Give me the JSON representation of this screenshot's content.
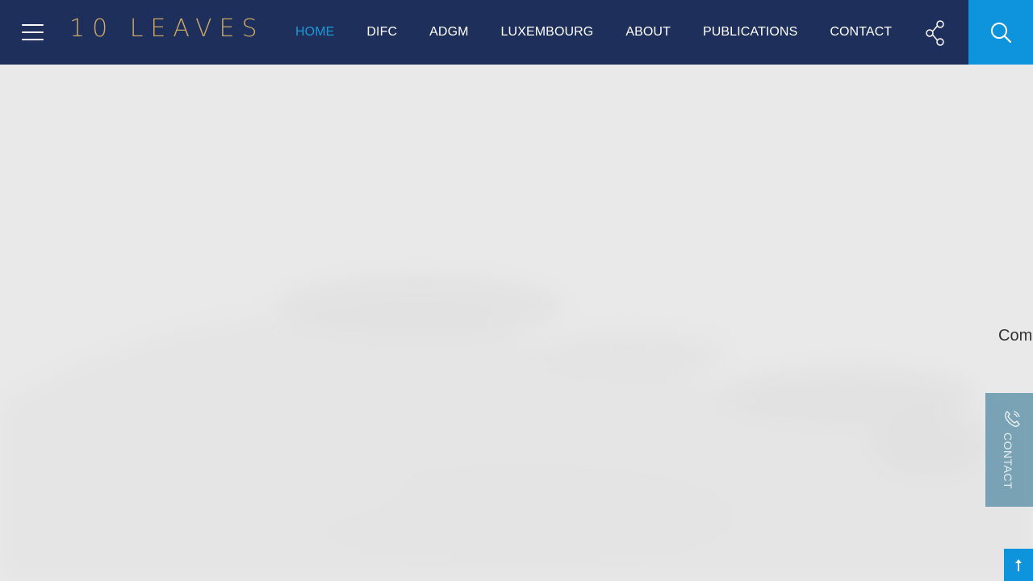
{
  "header": {
    "logo_text": "10 LEAVES",
    "nav": [
      {
        "label": "HOME",
        "active": true
      },
      {
        "label": "DIFC"
      },
      {
        "label": "ADGM"
      },
      {
        "label": "LUXEMBOURG"
      },
      {
        "label": "ABOUT"
      },
      {
        "label": "PUBLICATIONS"
      },
      {
        "label": "CONTACT"
      }
    ],
    "icons": {
      "menu": "hamburger-menu-icon",
      "share": "share-icon",
      "search": "search-icon"
    }
  },
  "hero": {
    "partial_text": "Com"
  },
  "contact_tab": {
    "label": "CONTACT",
    "icon": "phone-icon"
  },
  "back_to_top": {
    "icon": "arrow-up-icon"
  },
  "colors": {
    "header_bg": "#1f2f5b",
    "accent_blue": "#0e94dc",
    "active_nav": "#1b9ad8",
    "logo_gold": "#c8a765",
    "contact_tab_bg": "#6e9cb0",
    "hero_bg": "#e9e9e9"
  }
}
